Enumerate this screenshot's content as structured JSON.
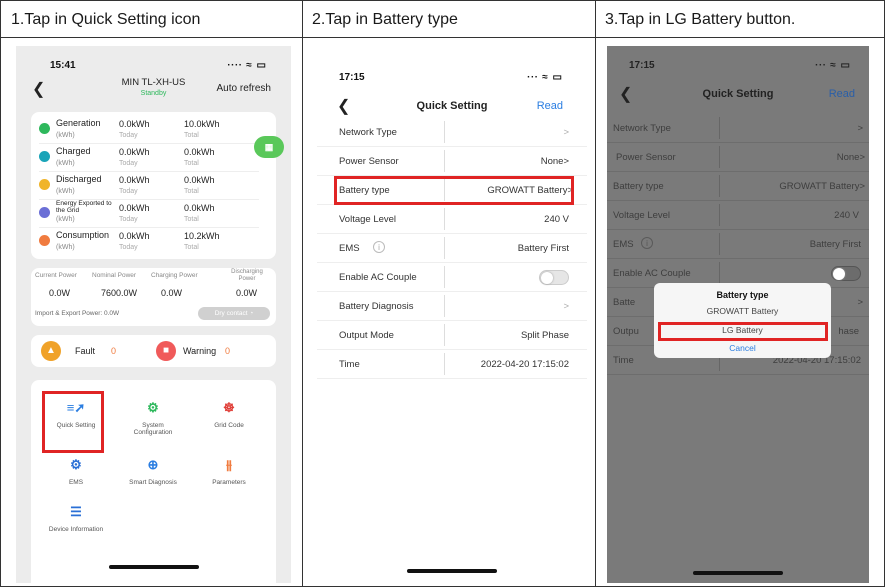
{
  "steps": [
    {
      "title": "1.Tap in Quick Setting icon"
    },
    {
      "title": "2.Tap in Battery type"
    },
    {
      "title": "3.Tap in LG Battery button."
    }
  ],
  "phone1": {
    "time": "15:41",
    "status_icons": "∙∙∙∙ ≈ ▭",
    "device_name": "MIN TL-XH-US",
    "device_status": "Standby",
    "auto_refresh": "Auto refresh",
    "energy": [
      {
        "label": "Generation",
        "unit": "(kWh)",
        "today": "0.0kWh",
        "today_label": "Today",
        "total": "10.0kWh",
        "total_label": "Total",
        "color": "#2eb85c"
      },
      {
        "label": "Charged",
        "unit": "(kWh)",
        "today": "0.0kWh",
        "today_label": "Today",
        "total": "0.0kWh",
        "total_label": "Total",
        "color": "#1aa4b8"
      },
      {
        "label": "Discharged",
        "unit": "(kWh)",
        "today": "0.0kWh",
        "today_label": "Today",
        "total": "0.0kWh",
        "total_label": "Total",
        "color": "#f0b429"
      },
      {
        "label": "Energy Exported to the Grid",
        "unit": "(kWh)",
        "today": "0.0kWh",
        "today_label": "Today",
        "total": "0.0kWh",
        "total_label": "Total",
        "color": "#6b6fd6"
      },
      {
        "label": "Consumption",
        "unit": "(kWh)",
        "today": "0.0kWh",
        "today_label": "Today",
        "total": "10.2kWh",
        "total_label": "Total",
        "color": "#f07b3f"
      }
    ],
    "power_headers": [
      "Current Power",
      "Nominal Power",
      "Charging Power",
      "Discharging Power"
    ],
    "power_values": [
      "0.0W",
      "7600.0W",
      "0.0W",
      "0.0W"
    ],
    "import_export": "Import & Export Power: 0.0W",
    "dry_contact": "Dry contact",
    "fault_label": "Fault",
    "fault_count": "0",
    "warning_label": "Warning",
    "warning_count": "0",
    "tools": [
      {
        "label": "Quick Setting",
        "icon": "quick-setting-icon",
        "glyph": "≡➚"
      },
      {
        "label": "System Configuration",
        "icon": "system-configuration-icon",
        "glyph": "⚙"
      },
      {
        "label": "Grid Code",
        "icon": "grid-code-icon",
        "glyph": "☸"
      },
      {
        "label": "EMS",
        "icon": "ems-icon",
        "glyph": "⚙"
      },
      {
        "label": "Smart Diagnosis",
        "icon": "smart-diagnosis-icon",
        "glyph": "⊕"
      },
      {
        "label": "Parameters",
        "icon": "parameters-icon",
        "glyph": "⫵"
      },
      {
        "label": "Device Information",
        "icon": "device-information-icon",
        "glyph": "☰"
      }
    ]
  },
  "phone2": {
    "time": "17:15",
    "status_icons": "∙∙∙ ≈ ▭",
    "title": "Quick Setting",
    "read": "Read",
    "rows": [
      {
        "label": "Network Type",
        "value": ">"
      },
      {
        "label": "Power Sensor",
        "value": "None>"
      },
      {
        "label": "Battery type",
        "value": "GROWATT Battery>"
      },
      {
        "label": "Voltage Level",
        "value": "240 V"
      },
      {
        "label": "EMS",
        "value": "Battery First"
      },
      {
        "label": "Enable AC Couple",
        "value": ""
      },
      {
        "label": "Battery Diagnosis",
        "value": ">"
      },
      {
        "label": "Output Mode",
        "value": "Split Phase"
      },
      {
        "label": "Time",
        "value": "2022-04-20 17:15:02"
      }
    ]
  },
  "phone3": {
    "time": "17:15",
    "status_icons": "∙∙∙ ≈ ▭",
    "title": "Quick Setting",
    "read": "Read",
    "rows": [
      {
        "label": "Network Type",
        "value": ">"
      },
      {
        "label": "Power Sensor",
        "value": "None>"
      },
      {
        "label": "Battery type",
        "value": "GROWATT Battery>"
      },
      {
        "label": "Voltage Level",
        "value": "240 V"
      },
      {
        "label": "EMS",
        "value": "Battery First"
      },
      {
        "label": "Enable AC Couple",
        "value": ""
      },
      {
        "label": "Batte",
        "value": ">"
      },
      {
        "label": "Outpu",
        "value": "hase"
      },
      {
        "label": "Time",
        "value": "2022-04-20 17:15:02"
      }
    ],
    "dialog": {
      "title": "Battery type",
      "option1": "GROWATT Battery",
      "option2": "LG Battery",
      "cancel": "Cancel"
    }
  },
  "colors": {
    "highlight": "#e02424",
    "link": "#2a7de1",
    "green": "#2eb85c"
  }
}
